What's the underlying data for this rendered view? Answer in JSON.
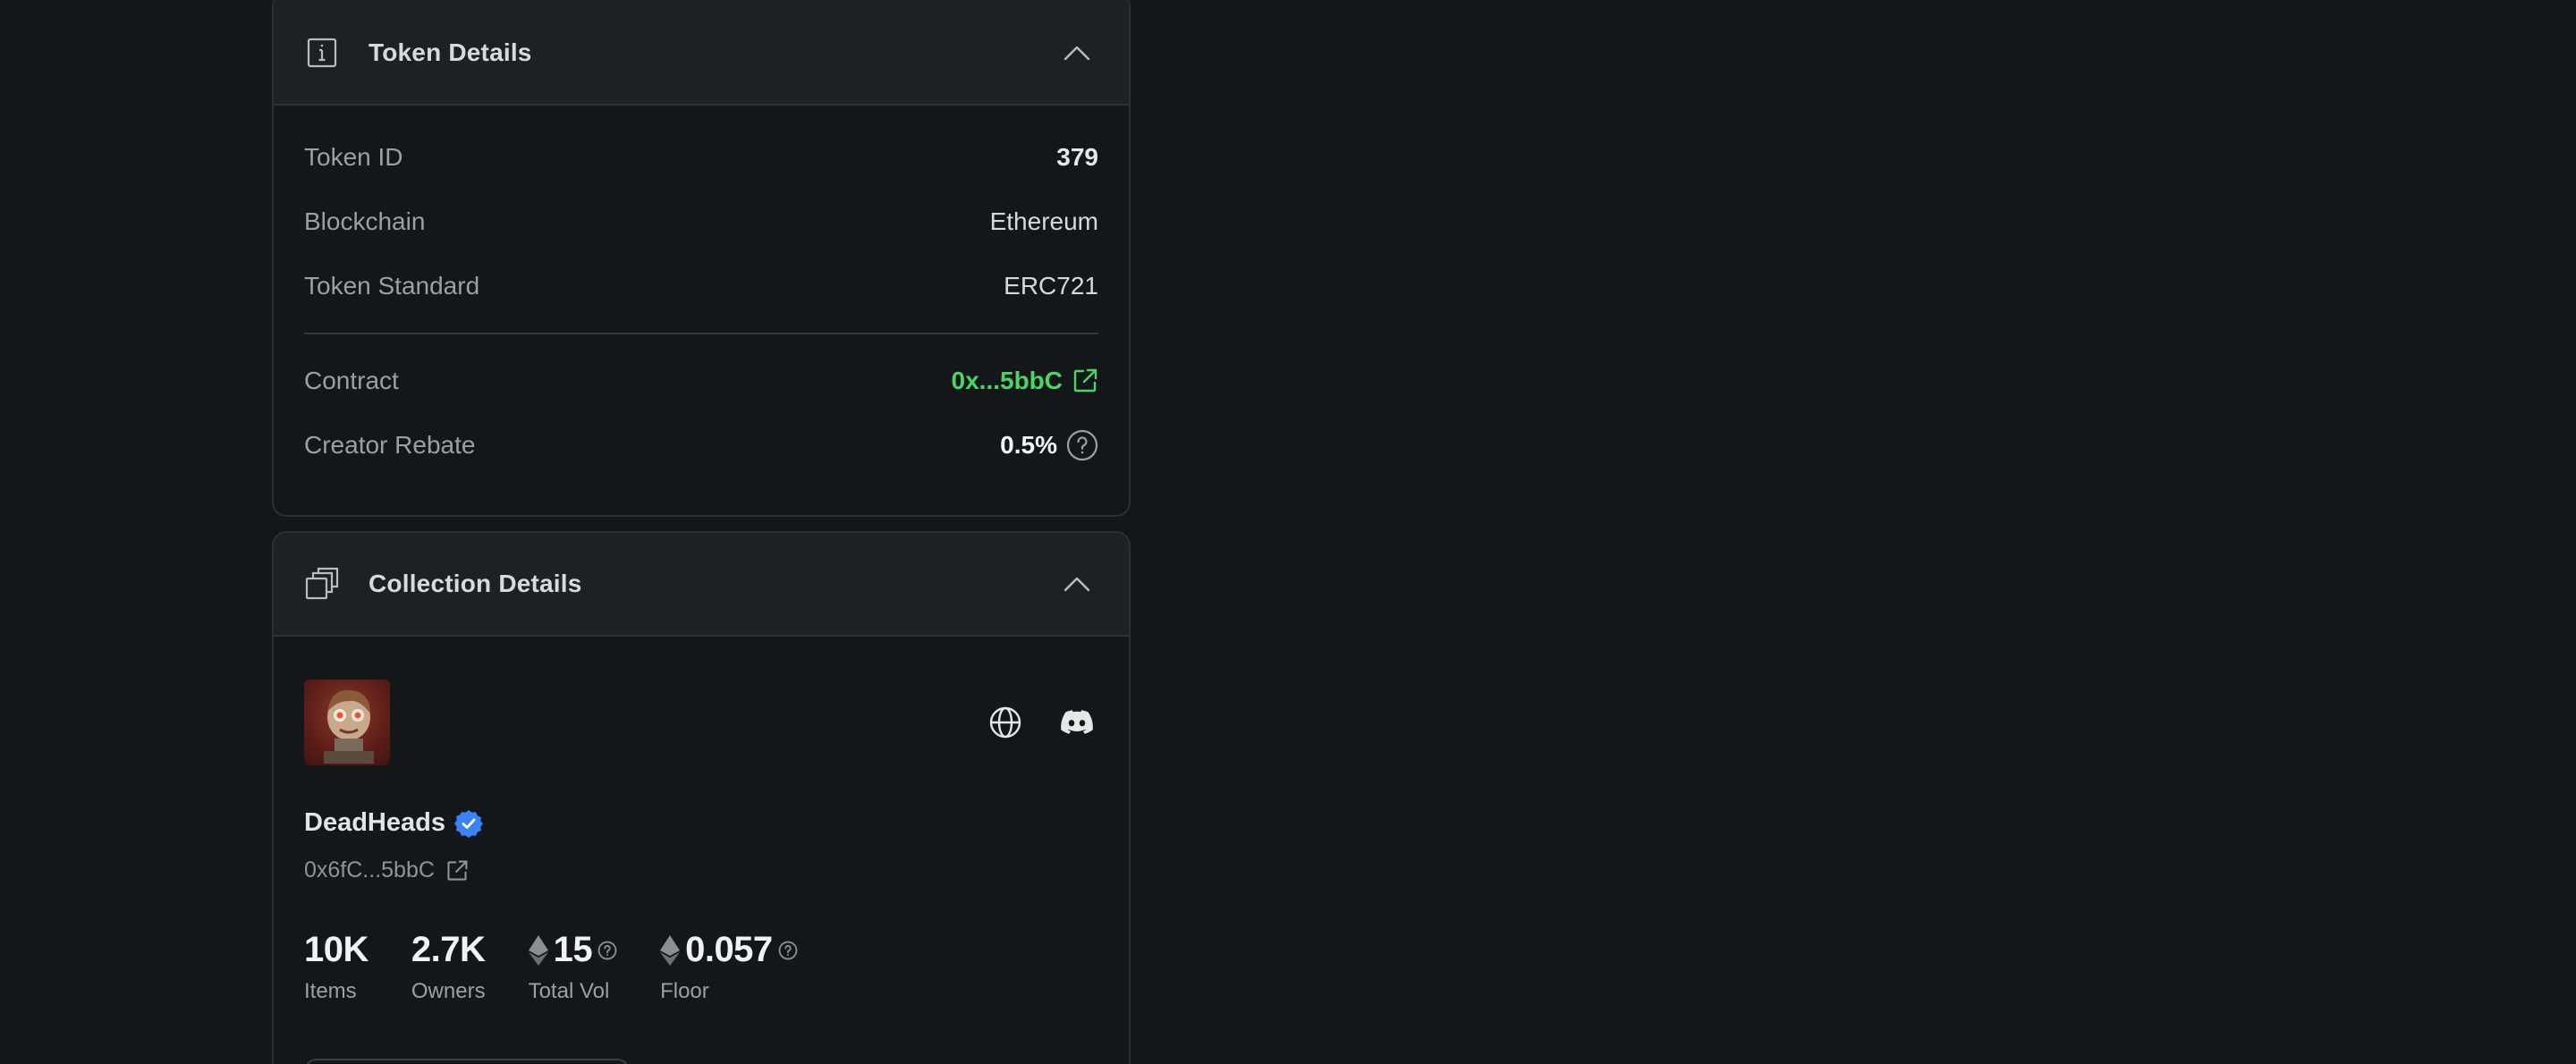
{
  "token_details": {
    "title": "Token Details",
    "rows": [
      {
        "label": "Token ID",
        "value": "379"
      },
      {
        "label": "Blockchain",
        "value": "Ethereum"
      },
      {
        "label": "Token Standard",
        "value": "ERC721"
      }
    ],
    "contract": {
      "label": "Contract",
      "value": "0x...5bbC"
    },
    "creator_rebate": {
      "label": "Creator Rebate",
      "value": "0.5%"
    }
  },
  "collection_details": {
    "title": "Collection Details",
    "name": "DeadHeads",
    "address": "0x6fC...5bbC",
    "stats": [
      {
        "value": "10K",
        "label": "Items",
        "eth": false,
        "help": false
      },
      {
        "value": "2.7K",
        "label": "Owners",
        "eth": false,
        "help": false
      },
      {
        "value": "15",
        "label": "Total Vol",
        "eth": true,
        "help": true
      },
      {
        "value": "0.057",
        "label": "Floor",
        "eth": true,
        "help": true
      }
    ]
  },
  "colors": {
    "background": "#131619",
    "accent_green": "#4cd464",
    "verified_blue": "#3b82f6"
  },
  "icons": {
    "token_header": "info-icon",
    "collection_header": "collection-icon",
    "collapse": "chevron-up-icon",
    "external": "external-link-icon",
    "help": "help-circle-icon",
    "website": "globe-icon",
    "discord": "discord-icon",
    "verified": "verified-badge-icon",
    "currency": "ethereum-icon"
  }
}
